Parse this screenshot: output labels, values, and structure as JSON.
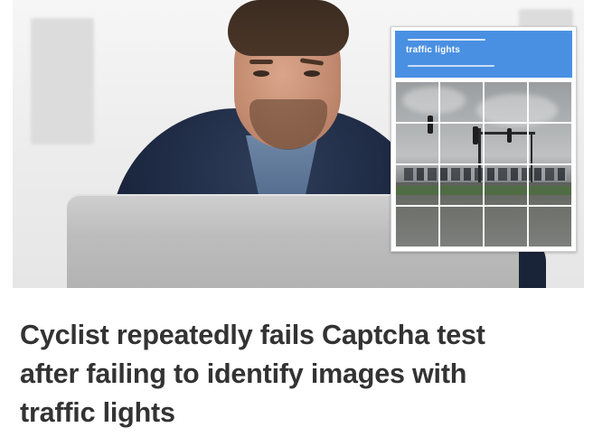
{
  "captcha": {
    "title": "traffic lights",
    "grid_rows": 4,
    "grid_cols": 4
  },
  "headline": {
    "line1": "Cyclist repeatedly fails Captcha test",
    "line2": "after failing to identify images with",
    "line3": "traffic lights"
  },
  "colors": {
    "captcha_header": "#4a90e2",
    "headline_text": "#333333"
  }
}
